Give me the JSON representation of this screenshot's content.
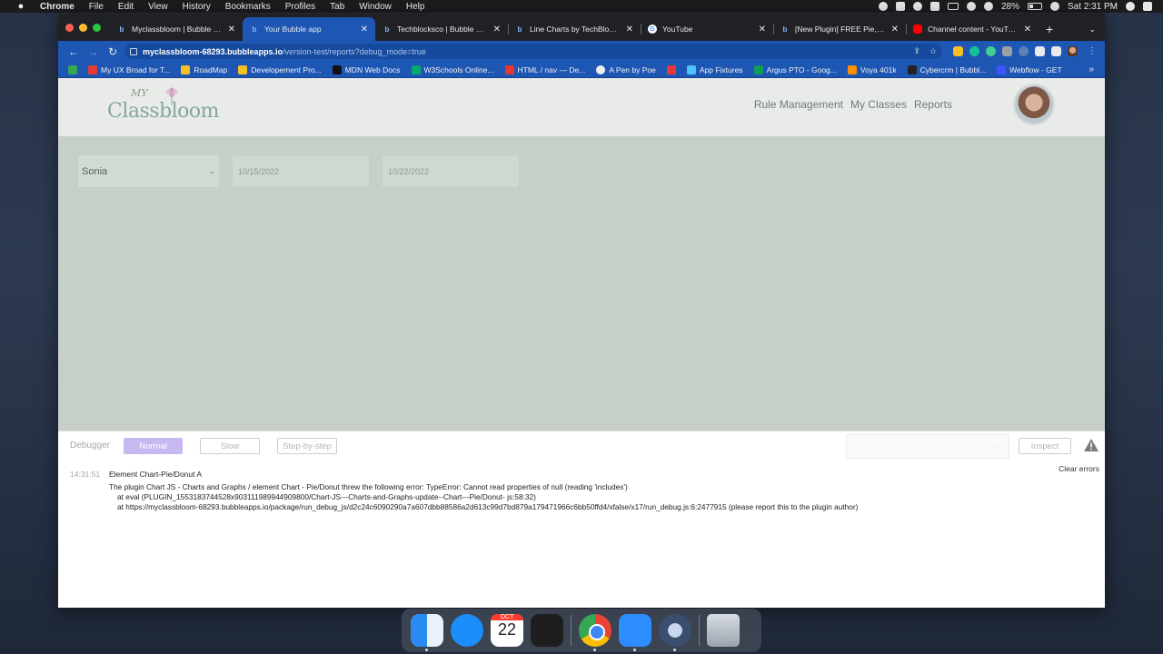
{
  "menubar": {
    "app_name": "Chrome",
    "items": [
      "File",
      "Edit",
      "View",
      "History",
      "Bookmarks",
      "Profiles",
      "Tab",
      "Window",
      "Help"
    ],
    "battery": "28%",
    "clock": "Sat 2:31 PM"
  },
  "tabs": [
    {
      "title": "Myclassbloom | Bubble Editor",
      "icon": "bubble-icon",
      "active": false
    },
    {
      "title": "Your Bubble app",
      "icon": "bubble-icon",
      "active": true
    },
    {
      "title": "Techblocksco | Bubble Editor",
      "icon": "bubble-icon",
      "active": false
    },
    {
      "title": "Line Charts by TechBlocks fo",
      "icon": "bubble-icon",
      "active": false
    },
    {
      "title": "YouTube",
      "icon": "google-icon",
      "active": false
    },
    {
      "title": "[New Plugin] FREE Pie, Donu",
      "icon": "bubble-icon",
      "active": false
    },
    {
      "title": "Channel content - YouTube S",
      "icon": "youtube-icon",
      "active": false
    }
  ],
  "omnibox": {
    "host": "myclassbloom-68293.bubbleapps.io",
    "path": "/version-test/reports?debug_mode=true"
  },
  "bookmarks": [
    {
      "label": "My UX Broad for T...",
      "color": "#e53935"
    },
    {
      "label": "RoadMap",
      "color": "#f6c026"
    },
    {
      "label": "Developement Pro...",
      "color": "#f6c026"
    },
    {
      "label": "MDN Web Docs",
      "color": "#111111"
    },
    {
      "label": "W3Schools Online...",
      "color": "#04aa6d"
    },
    {
      "label": "HTML / nav — De...",
      "color": "#e53935"
    },
    {
      "label": "A Pen by Poe",
      "color": "#eeeeee"
    },
    {
      "label": "",
      "color": "#e53935"
    },
    {
      "label": "App Fixtures",
      "color": "#4fc3f7"
    },
    {
      "label": "Argus PTO - Goog...",
      "color": "#0f9d58"
    },
    {
      "label": "Voya 401k",
      "color": "#ff8f00"
    },
    {
      "label": "Cybercrm | Bubbl...",
      "color": "#222222"
    },
    {
      "label": "Webflow - GET",
      "color": "#4353ff"
    }
  ],
  "app": {
    "logo_my": "MY",
    "logo_word": "Classbloom",
    "nav": [
      "Rule Management",
      "My Classes",
      "Reports"
    ]
  },
  "filters": {
    "student": "Sonia",
    "start_date": "10/15/2022",
    "end_date": "10/22/2022"
  },
  "debugger": {
    "label": "Debugger",
    "modes": [
      "Normal",
      "Slow",
      "Step-by-step"
    ],
    "active_mode": "Normal",
    "inspect_label": "Inspect",
    "clear_errors": "Clear errors",
    "log": {
      "time": "14:31:51",
      "element": "Element Chart-Pie/Donut A",
      "line1": "The plugin Chart JS - Charts and Graphs / element Chart - Pie/Donut threw the following error: TypeError: Cannot read properties of null (reading 'includes')",
      "line2": "at eval (PLUGIN_1553183744528x903111989944909800/Chart-JS---Charts-and-Graphs-update--Chart---Pie/Donut- js:58:32)",
      "line3": "at https://myclassbloom-68293.bubbleapps.io/package/run_debug_js/d2c24c6090290a7a607dbb88586a2d613c99d7bd879a179471966c6bb50ffd4/xfalse/x17/run_debug.js:6:2477915 (please report this to the plugin author)"
    }
  },
  "dock": {
    "calendar_month": "OCT",
    "calendar_day": "22"
  }
}
